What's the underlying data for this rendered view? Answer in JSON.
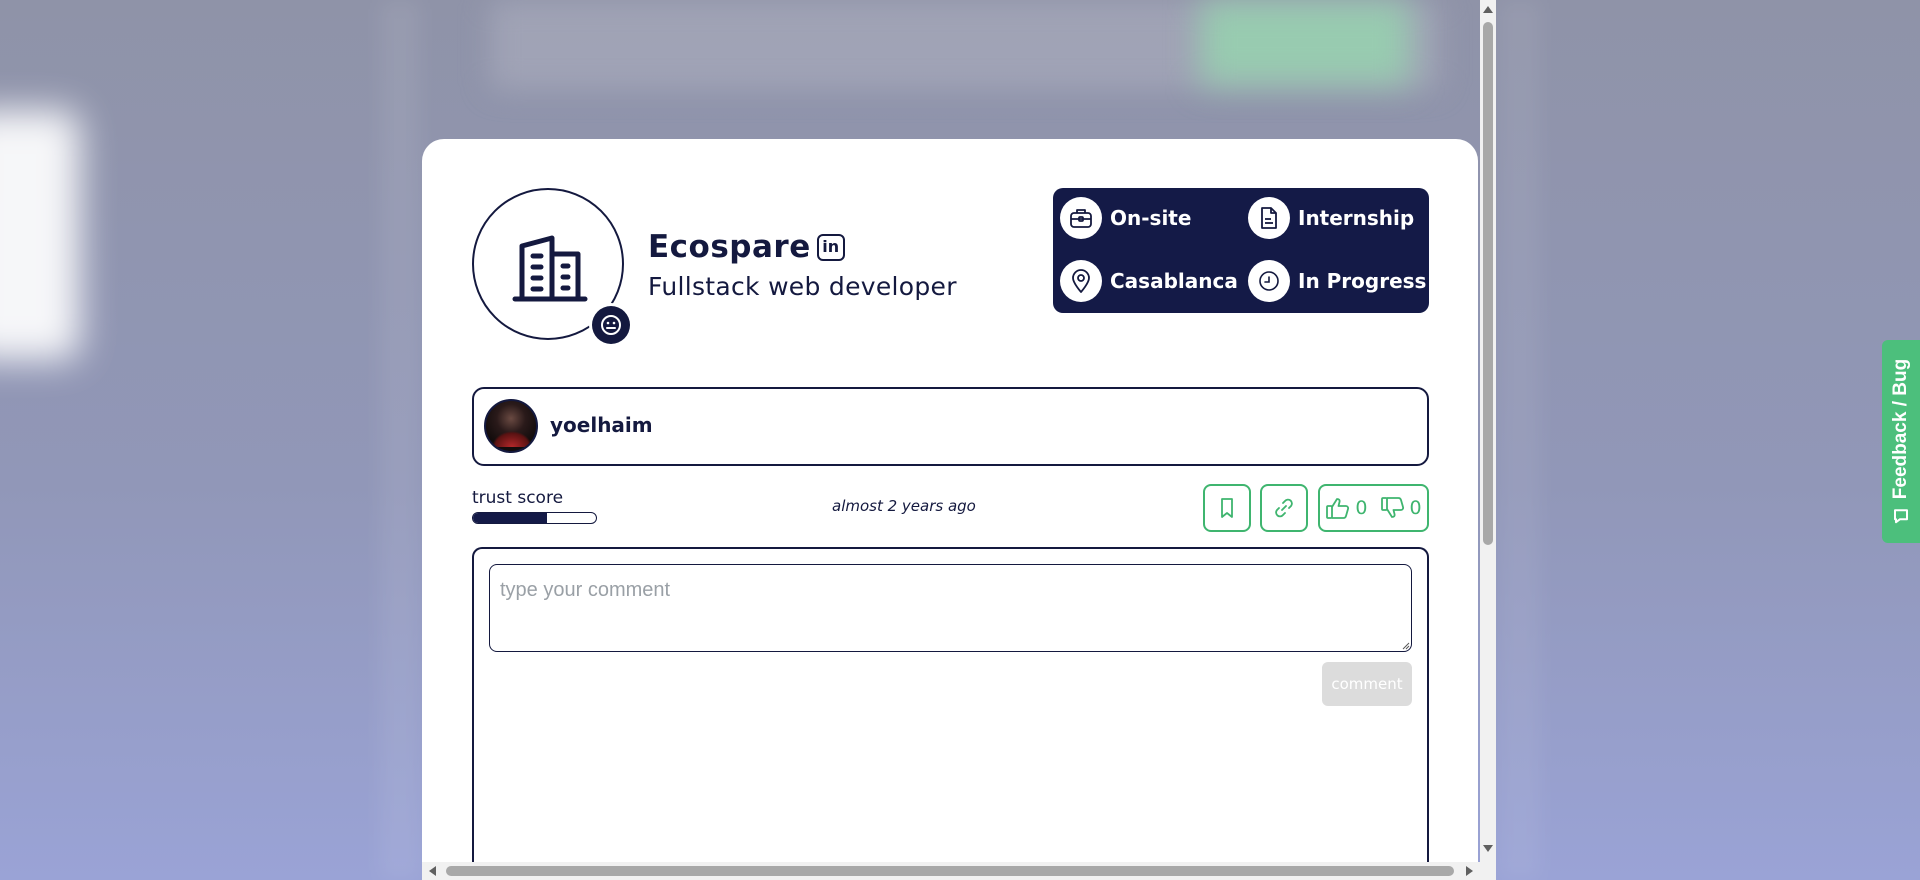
{
  "company": {
    "name": "Ecospare",
    "linkedin_label": "in",
    "job_title": "Fullstack web developer"
  },
  "tags": [
    {
      "icon": "briefcase-icon",
      "label": "On-site"
    },
    {
      "icon": "document-icon",
      "label": "Internship"
    },
    {
      "icon": "location-pin-icon",
      "label": "Casablanca"
    },
    {
      "icon": "clock-icon",
      "label": "In Progress"
    }
  ],
  "poster": {
    "username": "yoelhaim"
  },
  "trust": {
    "label": "trust score",
    "value": 0.6
  },
  "post_meta": {
    "timestamp": "almost 2 years ago"
  },
  "votes": {
    "likes": "0",
    "dislikes": "0"
  },
  "comments": {
    "placeholder": "type your comment",
    "submit_label": "comment"
  },
  "feedback": {
    "label": "Feedback / Bug"
  },
  "colors": {
    "navy": "#141a47",
    "accent_green": "#3fb56f",
    "feedback_green": "#4cbf7c",
    "disabled_button": "#dcdcdc"
  }
}
